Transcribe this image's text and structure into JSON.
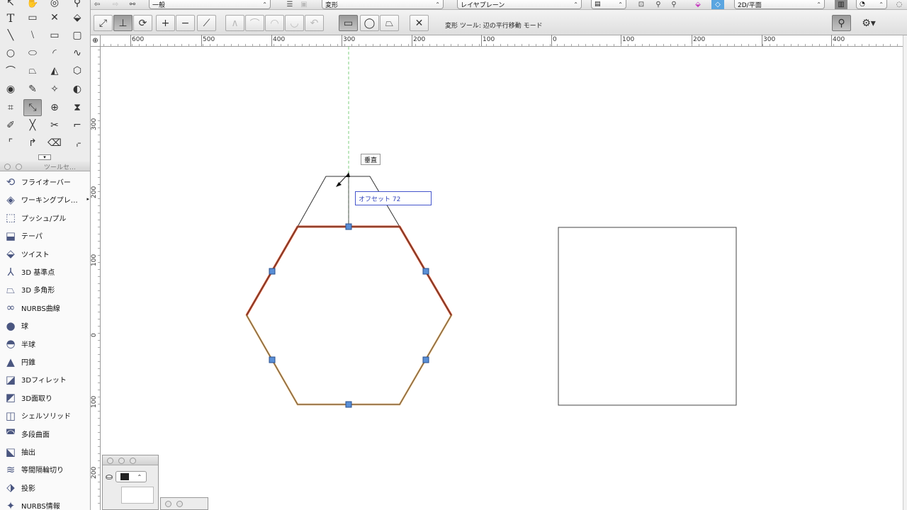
{
  "view_bar": {
    "class_dropdown": "一般",
    "layer_dropdown": "変形",
    "plane_dropdown": "レイヤプレーン",
    "view_dropdown": "2D/平面"
  },
  "mode_bar": {
    "status": "変形 ツール: 辺の平行移動 モード"
  },
  "ruler": {
    "h_labels": [
      "600",
      "500",
      "400",
      "300",
      "200",
      "100",
      "0",
      "100",
      "200",
      "300",
      "400"
    ],
    "v_labels": [
      "300",
      "200",
      "100",
      "0",
      "100",
      "200"
    ],
    "origin": "⊕"
  },
  "toolset": {
    "title": "ツールセ…",
    "items": [
      {
        "label": "フライオーバー",
        "icon": "flyover-icon"
      },
      {
        "label": "ワーキングプレ…",
        "icon": "working-plane-icon"
      },
      {
        "label": "プッシュ/プル",
        "icon": "push-pull-icon"
      },
      {
        "label": "テーパ",
        "icon": "taper-icon"
      },
      {
        "label": "ツイスト",
        "icon": "twist-icon"
      },
      {
        "label": "3D 基準点",
        "icon": "3d-locus-icon"
      },
      {
        "label": "3D 多角形",
        "icon": "3d-polygon-icon"
      },
      {
        "label": "NURBS曲線",
        "icon": "nurbs-curve-icon"
      },
      {
        "label": "球",
        "icon": "sphere-icon"
      },
      {
        "label": "半球",
        "icon": "hemisphere-icon"
      },
      {
        "label": "円錐",
        "icon": "cone-icon"
      },
      {
        "label": "3Dフィレット",
        "icon": "3d-fillet-icon"
      },
      {
        "label": "3D面取り",
        "icon": "3d-chamfer-icon"
      },
      {
        "label": "シェルソリッド",
        "icon": "shell-solid-icon"
      },
      {
        "label": "多段曲面",
        "icon": "loft-surface-icon"
      },
      {
        "label": "抽出",
        "icon": "extract-icon"
      },
      {
        "label": "等間隔輪切り",
        "icon": "contour-icon"
      },
      {
        "label": "投影",
        "icon": "project-icon"
      },
      {
        "label": "NURBS情報",
        "icon": "nurbs-info-icon"
      }
    ]
  },
  "canvas": {
    "snap_hint": "垂直",
    "offset_field": "オフセット 72"
  },
  "colors": {
    "selected_edge": "#c84a2a",
    "hexagon_outline": "#d9a25a",
    "handle": "#5a8fd6",
    "guide": "#7fcf7f"
  }
}
